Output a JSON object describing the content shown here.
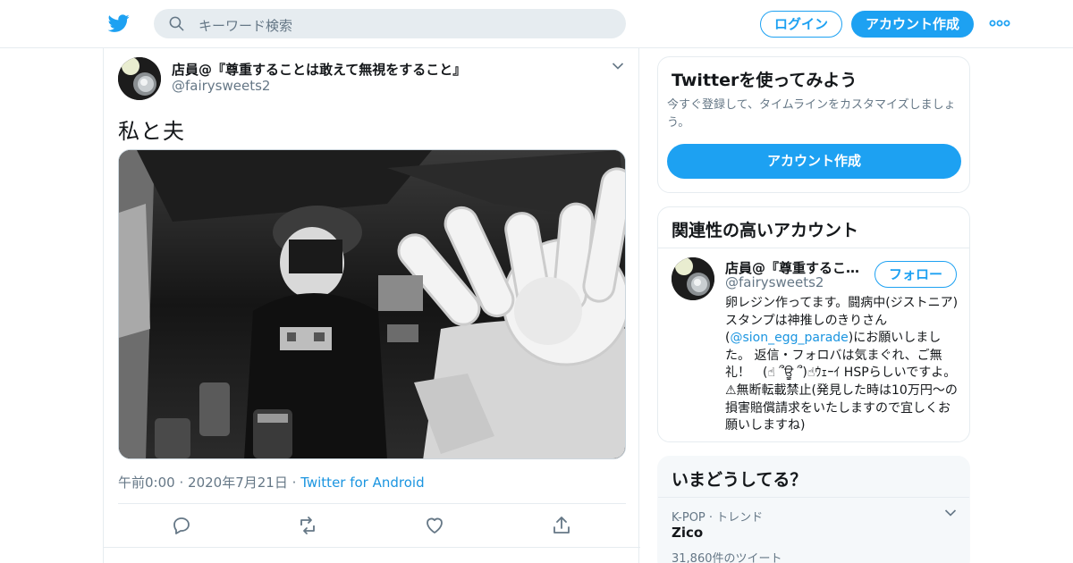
{
  "header": {
    "search_placeholder": "キーワード検索",
    "login_label": "ログイン",
    "signup_label": "アカウント作成",
    "icons": [
      "twitter-bird-icon",
      "search-icon",
      "more-icon"
    ],
    "accent_color": "#1da1f2"
  },
  "tweet": {
    "display_name": "店員@『尊重することは敢えて無視をすること』",
    "handle": "@fairysweets2",
    "text": "私と夫",
    "time": "午前0:00",
    "dot1": "·",
    "date": "2020年7月21日",
    "dot2": "·",
    "source": "Twitter for Android",
    "actions": [
      "reply-icon",
      "retweet-icon",
      "like-icon",
      "share-icon"
    ]
  },
  "signup_card": {
    "title": "Twitterを使ってみよう",
    "description": "今すぐ登録して、タイムラインをカスタマイズしましょう。",
    "button": "アカウント作成"
  },
  "related": {
    "title": "関連性の高いアカウント",
    "account": {
      "name": "店員@『尊重するこ…",
      "handle": "@fairysweets2",
      "follow_label": "フォロー",
      "bio_before": "卵レジン作ってます。闘病中(ジストニア) スタンプは神推しのきりさん(",
      "bio_mention": "@sion_egg_parade",
      "bio_after": ")にお願いしました。 返信・フォロバは気まぐれ、ご無礼！　(☝ ՞ਊ ՞)☝ｳｪｰｲ HSPらしいですよ。⚠無断転載禁止(発見した時は10万円〜の損害賠償請求をいたしますので宜しくお願いしますね)"
    }
  },
  "trends": {
    "title": "いまどうしてる？",
    "items": [
      {
        "context": "K-POP · トレンド",
        "name": "Zico",
        "count": "31,860件のツイート"
      }
    ]
  }
}
